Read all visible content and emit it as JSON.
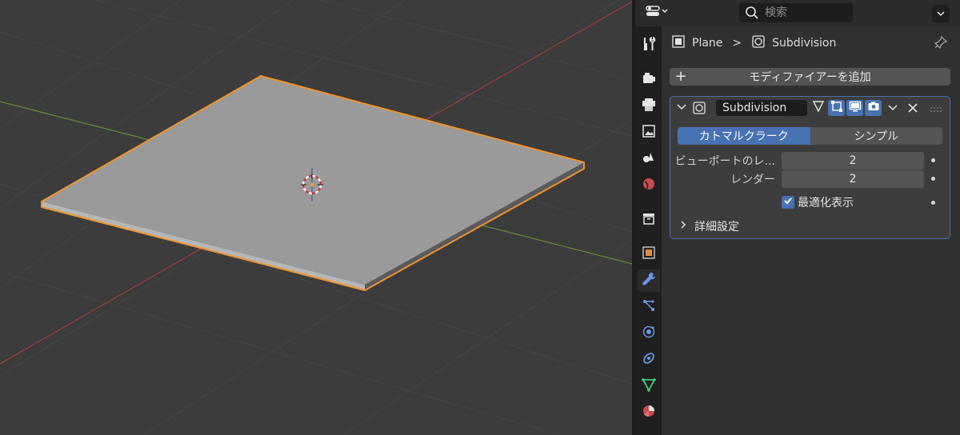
{
  "header": {
    "search_placeholder": "検索",
    "editor_type_icon": "properties-editor-icon",
    "options_icon": "chevron-down-icon"
  },
  "breadcrumb": {
    "object": "Plane",
    "separator": ">",
    "modifier": "Subdivision"
  },
  "tabs": [
    {
      "name": "tool",
      "icon": "wrench-screwdriver-icon"
    },
    {
      "name": "render",
      "icon": "camera-back-icon"
    },
    {
      "name": "output",
      "icon": "printer-icon"
    },
    {
      "name": "view-layer",
      "icon": "image-icon"
    },
    {
      "name": "scene",
      "icon": "scene-icon"
    },
    {
      "name": "world",
      "icon": "world-icon"
    },
    {
      "name": "collection",
      "icon": "box-icon"
    },
    {
      "name": "object",
      "icon": "orange-square-icon"
    },
    {
      "name": "modifiers",
      "icon": "wrench-icon",
      "active": true
    },
    {
      "name": "particles",
      "icon": "particles-icon"
    },
    {
      "name": "physics",
      "icon": "physics-icon"
    },
    {
      "name": "constraints",
      "icon": "constraint-icon"
    },
    {
      "name": "data",
      "icon": "green-triangle-icon"
    },
    {
      "name": "material",
      "icon": "material-sphere-icon"
    }
  ],
  "add_modifier": {
    "label": "モディファイアーを追加"
  },
  "modifier": {
    "name": "Subdivision",
    "method_options": [
      "カトマルクラーク",
      "シンプル"
    ],
    "method_selected": "カトマルクラーク",
    "viewport_label": "ビューポートのレ...",
    "viewport_value": "2",
    "render_label": "レンダー",
    "render_value": "2",
    "optimal_label": "最適化表示",
    "optimal_checked": true,
    "advanced_label": "詳細設定"
  },
  "colors": {
    "accent": "#4772b3",
    "selection": "#f0932b",
    "x_axis": "#a83a43",
    "y_axis": "#6a8c32"
  }
}
